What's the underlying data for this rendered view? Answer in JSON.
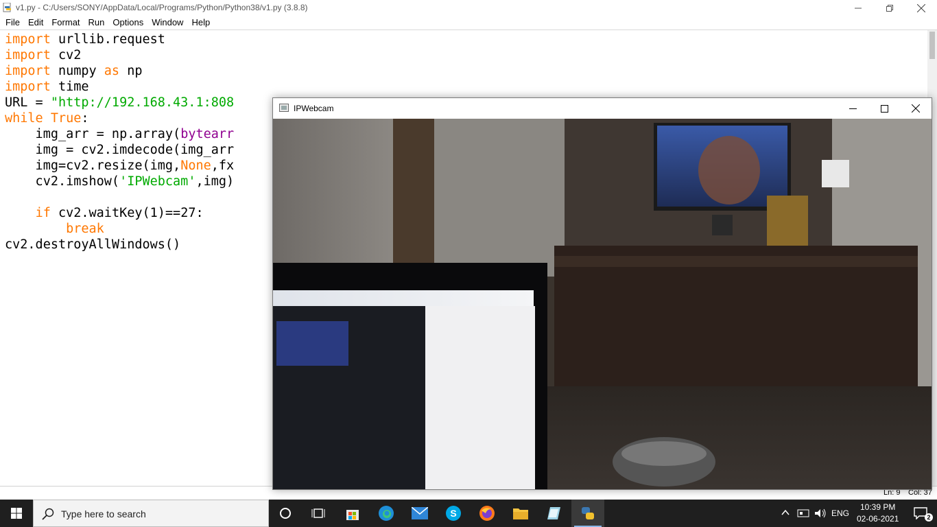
{
  "idle": {
    "title": "v1.py - C:/Users/SONY/AppData/Local/Programs/Python/Python38/v1.py (3.8.8)",
    "menu": [
      "File",
      "Edit",
      "Format",
      "Run",
      "Options",
      "Window",
      "Help"
    ],
    "code_lines": [
      "import urllib.request",
      "import cv2",
      "import numpy as np",
      "import time",
      "URL = \"http://192.168.43.1:808",
      "while True:",
      "    img_arr = np.array(bytearr",
      "    img = cv2.imdecode(img_arr",
      "    img=cv2.resize(img,None,fx",
      "    cv2.imshow('IPWebcam',img)",
      "",
      "    if cv2.waitKey(1)==27:",
      "        break",
      "cv2.destroyAllWindows()"
    ],
    "status": {
      "line": "Ln: 9",
      "col": "Col: 37"
    }
  },
  "webcam": {
    "title": "IPWebcam"
  },
  "taskbar": {
    "search_placeholder": "Type here to search",
    "language": "ENG",
    "time": "10:39 PM",
    "date": "02-06-2021",
    "notification_count": "2"
  },
  "colors": {
    "keyword": "#ff7700",
    "string": "#00aa00",
    "builtin": "#900090",
    "taskbar": "#1f1f1f"
  }
}
